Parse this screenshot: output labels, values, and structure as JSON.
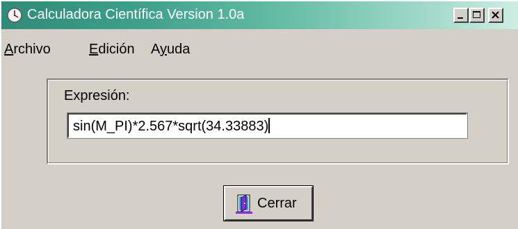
{
  "window": {
    "title": "Calculadora Científica Version 1.0a",
    "icons": {
      "app": "clock-icon",
      "minimize": "minimize-icon",
      "maximize": "maximize-icon",
      "close": "close-icon"
    },
    "colors": {
      "titlebar_start": "#2e8b77",
      "titlebar_end": "#cfeee4",
      "face": "#d4d0c8"
    }
  },
  "menu": {
    "items": [
      {
        "accel": "A",
        "rest": "rchivo"
      },
      {
        "accel": "E",
        "rest": "dición"
      },
      {
        "prefix": "A",
        "accel": "y",
        "rest": "uda"
      }
    ]
  },
  "form": {
    "expression_label": "Expresión:",
    "expression_value": "sin(M_PI)*2.567*sqrt(34.33883)"
  },
  "buttons": {
    "close_label": "Cerrar",
    "close_icon": "door-exit-icon"
  }
}
